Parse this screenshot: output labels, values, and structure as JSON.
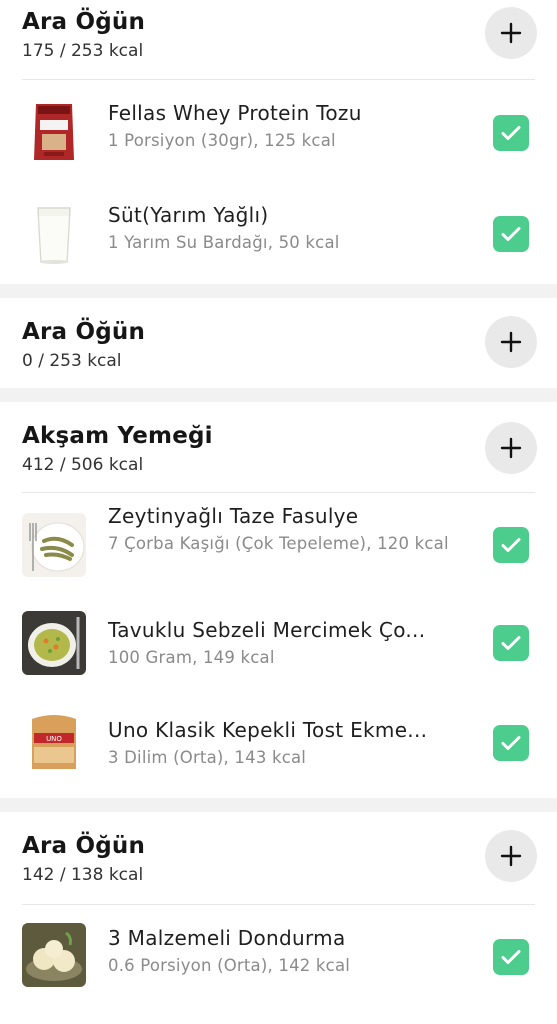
{
  "meals": [
    {
      "title": "Ara Öğün",
      "kcal": "175 / 253 kcal",
      "foods": [
        {
          "name": "Fellas Whey Protein Tozu",
          "detail": "1 Porsiyon (30gr), 125 kcal",
          "icon": "protein-pouch",
          "checked": true
        },
        {
          "name": "Süt(Yarım Yağlı)",
          "detail": "1 Yarım Su Bardağı, 50 kcal",
          "icon": "milk-glass",
          "checked": true
        }
      ]
    },
    {
      "title": "Ara Öğün",
      "kcal": "0 / 253 kcal",
      "foods": []
    },
    {
      "title": "Akşam Yemeği",
      "kcal": "412 / 506 kcal",
      "foods": [
        {
          "name": "Zeytinyağlı Taze Fasulye",
          "detail": "7 Çorba Kaşığı (Çok Tepeleme), 120 kcal",
          "icon": "green-beans-plate",
          "checked": true
        },
        {
          "name": "Tavuklu Sebzeli Mercimek Ço...",
          "detail": "100 Gram, 149 kcal",
          "icon": "lentil-soup-bowl",
          "checked": true
        },
        {
          "name": "Uno Klasik Kepekli Tost Ekme...",
          "detail": "3 Dilim (Orta), 143 kcal",
          "icon": "bread-package",
          "checked": true
        }
      ]
    },
    {
      "title": "Ara Öğün",
      "kcal": "142 / 138 kcal",
      "foods": [
        {
          "name": "3 Malzemeli Dondurma",
          "detail": "0.6 Porsiyon (Orta), 142 kcal",
          "icon": "ice-cream-scoops",
          "checked": true
        }
      ]
    }
  ],
  "colors": {
    "check": "#4ccd8d",
    "add_button_bg": "#e9e9e9",
    "background": "#f2f2f2"
  }
}
